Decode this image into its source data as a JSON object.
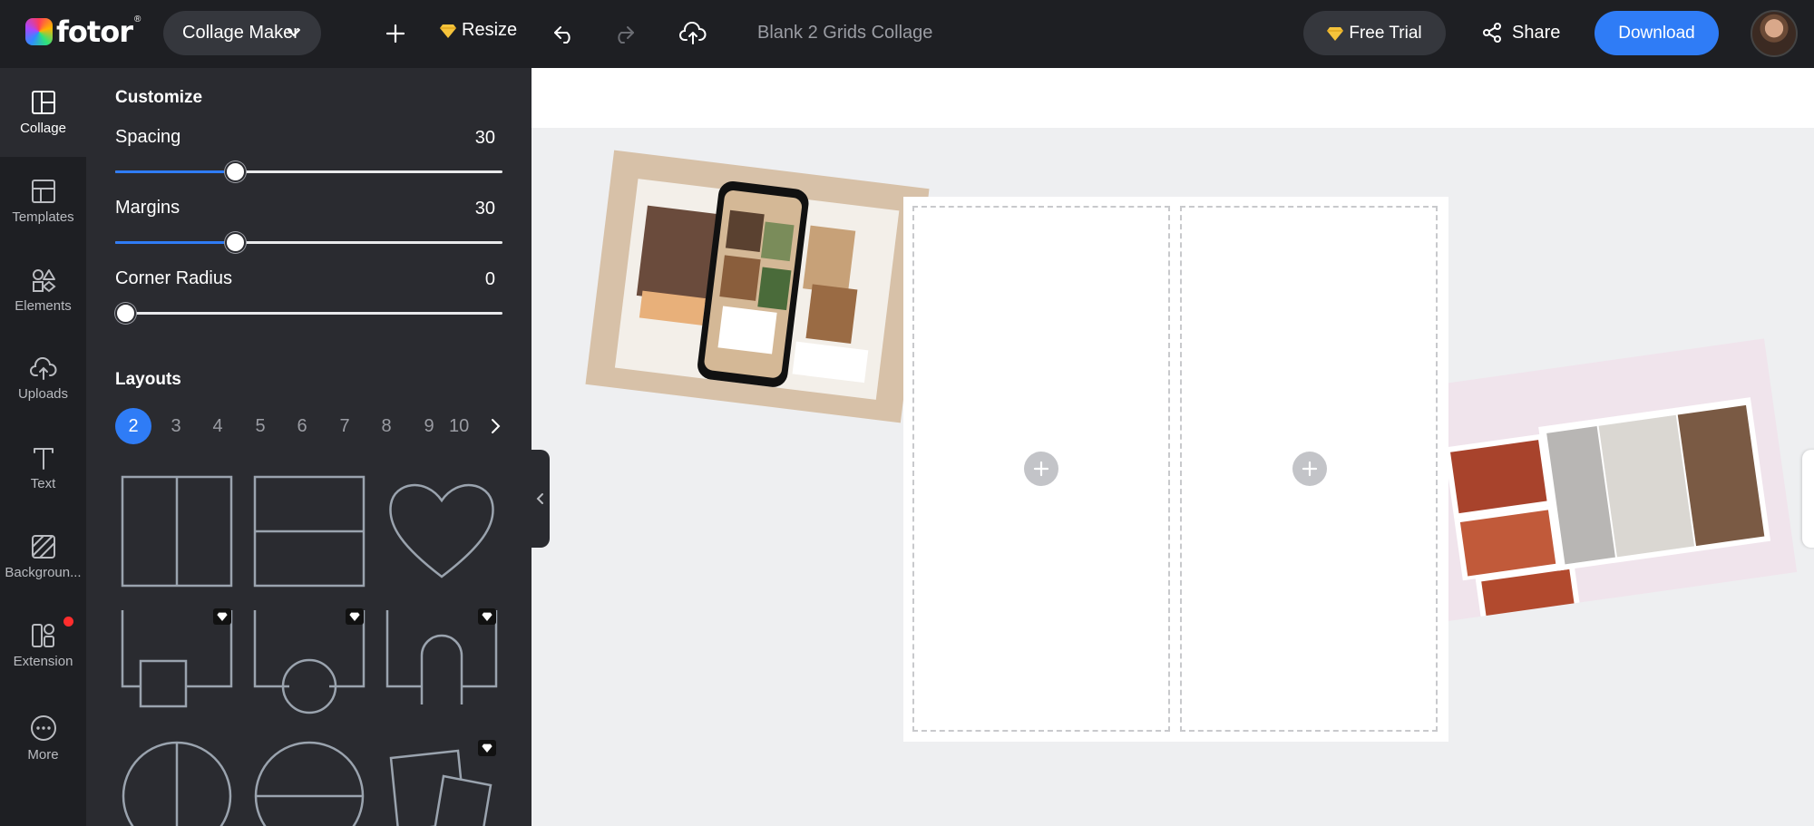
{
  "topbar": {
    "logo_text": "fotor",
    "logo_mark": "®",
    "tool_select": "Collage Maker",
    "resize_label": "Resize",
    "doc_title": "Blank 2 Grids Collage",
    "free_trial_label": "Free Trial",
    "share_label": "Share",
    "download_label": "Download"
  },
  "rail": {
    "items": [
      {
        "label": "Collage",
        "icon": "collage-icon"
      },
      {
        "label": "Templates",
        "icon": "templates-icon"
      },
      {
        "label": "Elements",
        "icon": "elements-icon"
      },
      {
        "label": "Uploads",
        "icon": "uploads-icon"
      },
      {
        "label": "Text",
        "icon": "text-icon"
      },
      {
        "label": "Backgroun...",
        "icon": "background-icon"
      },
      {
        "label": "Extension",
        "icon": "extension-icon"
      },
      {
        "label": "More",
        "icon": "more-icon"
      }
    ]
  },
  "panel": {
    "customize_title": "Customize",
    "sliders": [
      {
        "label": "Spacing",
        "value": "30",
        "fraction": 0.31
      },
      {
        "label": "Margins",
        "value": "30",
        "fraction": 0.31
      },
      {
        "label": "Corner Radius",
        "value": "0",
        "fraction": 0.0
      }
    ],
    "layouts_title": "Layouts",
    "pages": [
      "2",
      "3",
      "4",
      "5",
      "6",
      "7",
      "8",
      "9",
      "10"
    ],
    "active_page": "2"
  },
  "colors": {
    "accent": "#2f7cf6",
    "topbar_bg": "#1e1f23",
    "panel_bg": "#2a2b30",
    "canvas_bg": "#eeeff1"
  }
}
